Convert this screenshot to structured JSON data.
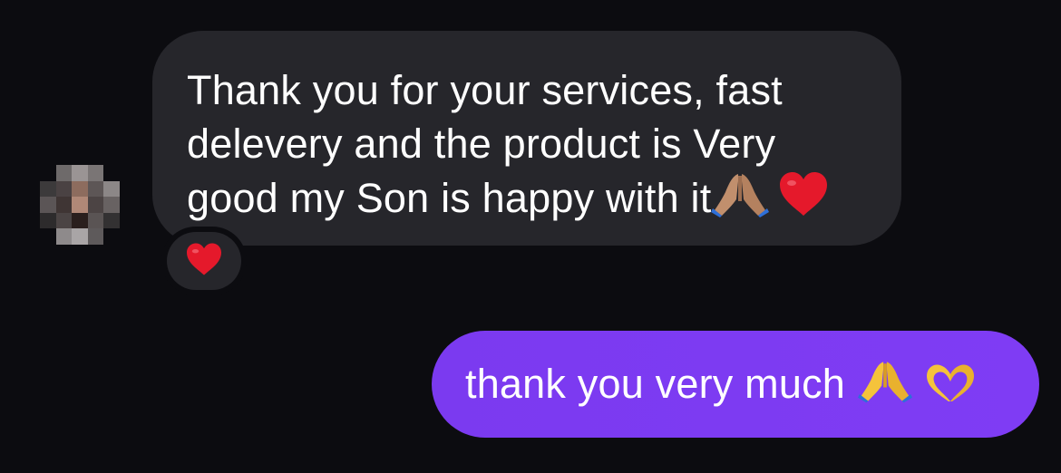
{
  "conversation": {
    "incoming": {
      "line1": "Thank you for your services, fast",
      "line2": "delevery and the product is Very",
      "line3": "good my Son is happy with it",
      "trailing_emojis": [
        "folded-hands-medium-skin-icon",
        "red-heart-icon"
      ],
      "reaction": "red-heart-icon"
    },
    "outgoing": {
      "text": "thank you very much",
      "trailing_emojis": [
        "folded-hands-icon",
        "heart-hands-icon"
      ]
    }
  },
  "colors": {
    "background": "#0c0c10",
    "incoming_bubble": "#26262b",
    "outgoing_bubble": "#7b3af0",
    "text": "#ffffff"
  }
}
